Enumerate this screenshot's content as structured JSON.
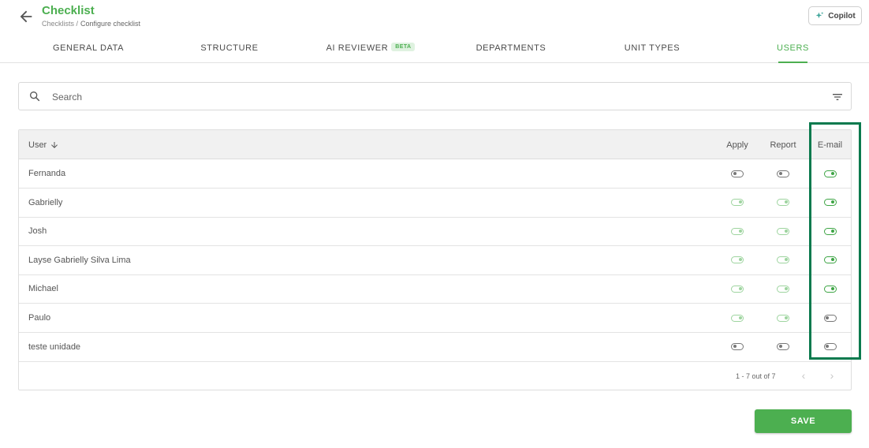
{
  "header": {
    "title": "Checklist",
    "breadcrumb": {
      "parent": "Checklists /",
      "current": "Configure checklist"
    },
    "copilot_label": "Copilot"
  },
  "tabs": [
    {
      "label": "GENERAL DATA",
      "active": false
    },
    {
      "label": "STRUCTURE",
      "active": false
    },
    {
      "label": "AI REVIEWER",
      "badge": "BETA",
      "active": false
    },
    {
      "label": "DEPARTMENTS",
      "active": false
    },
    {
      "label": "UNIT TYPES",
      "active": false
    },
    {
      "label": "USERS",
      "active": true
    }
  ],
  "search": {
    "placeholder": "Search"
  },
  "table": {
    "columns": {
      "user": "User",
      "apply": "Apply",
      "report": "Report",
      "email": "E-mail"
    },
    "rows": [
      {
        "name": "Fernanda",
        "apply": "off",
        "report": "off",
        "email": "on"
      },
      {
        "name": "Gabrielly",
        "apply": "on-faded",
        "report": "on-faded",
        "email": "on"
      },
      {
        "name": "Josh",
        "apply": "on-faded",
        "report": "on-faded",
        "email": "on"
      },
      {
        "name": "Layse Gabrielly Silva Lima",
        "apply": "on-faded",
        "report": "on-faded",
        "email": "on"
      },
      {
        "name": "Michael",
        "apply": "on-faded",
        "report": "on-faded",
        "email": "on"
      },
      {
        "name": "Paulo",
        "apply": "on-faded",
        "report": "on-faded",
        "email": "off"
      },
      {
        "name": "teste unidade",
        "apply": "off",
        "report": "off",
        "email": "off"
      }
    ],
    "pagination": {
      "info": "1 - 7 out of 7"
    }
  },
  "save_label": "SAVE",
  "colors": {
    "primary": "#4caf50",
    "highlight": "#0b7a4e",
    "toggle_on": "#3ea545",
    "toggle_on_faded": "#9ed49f",
    "toggle_off": "#777777"
  }
}
